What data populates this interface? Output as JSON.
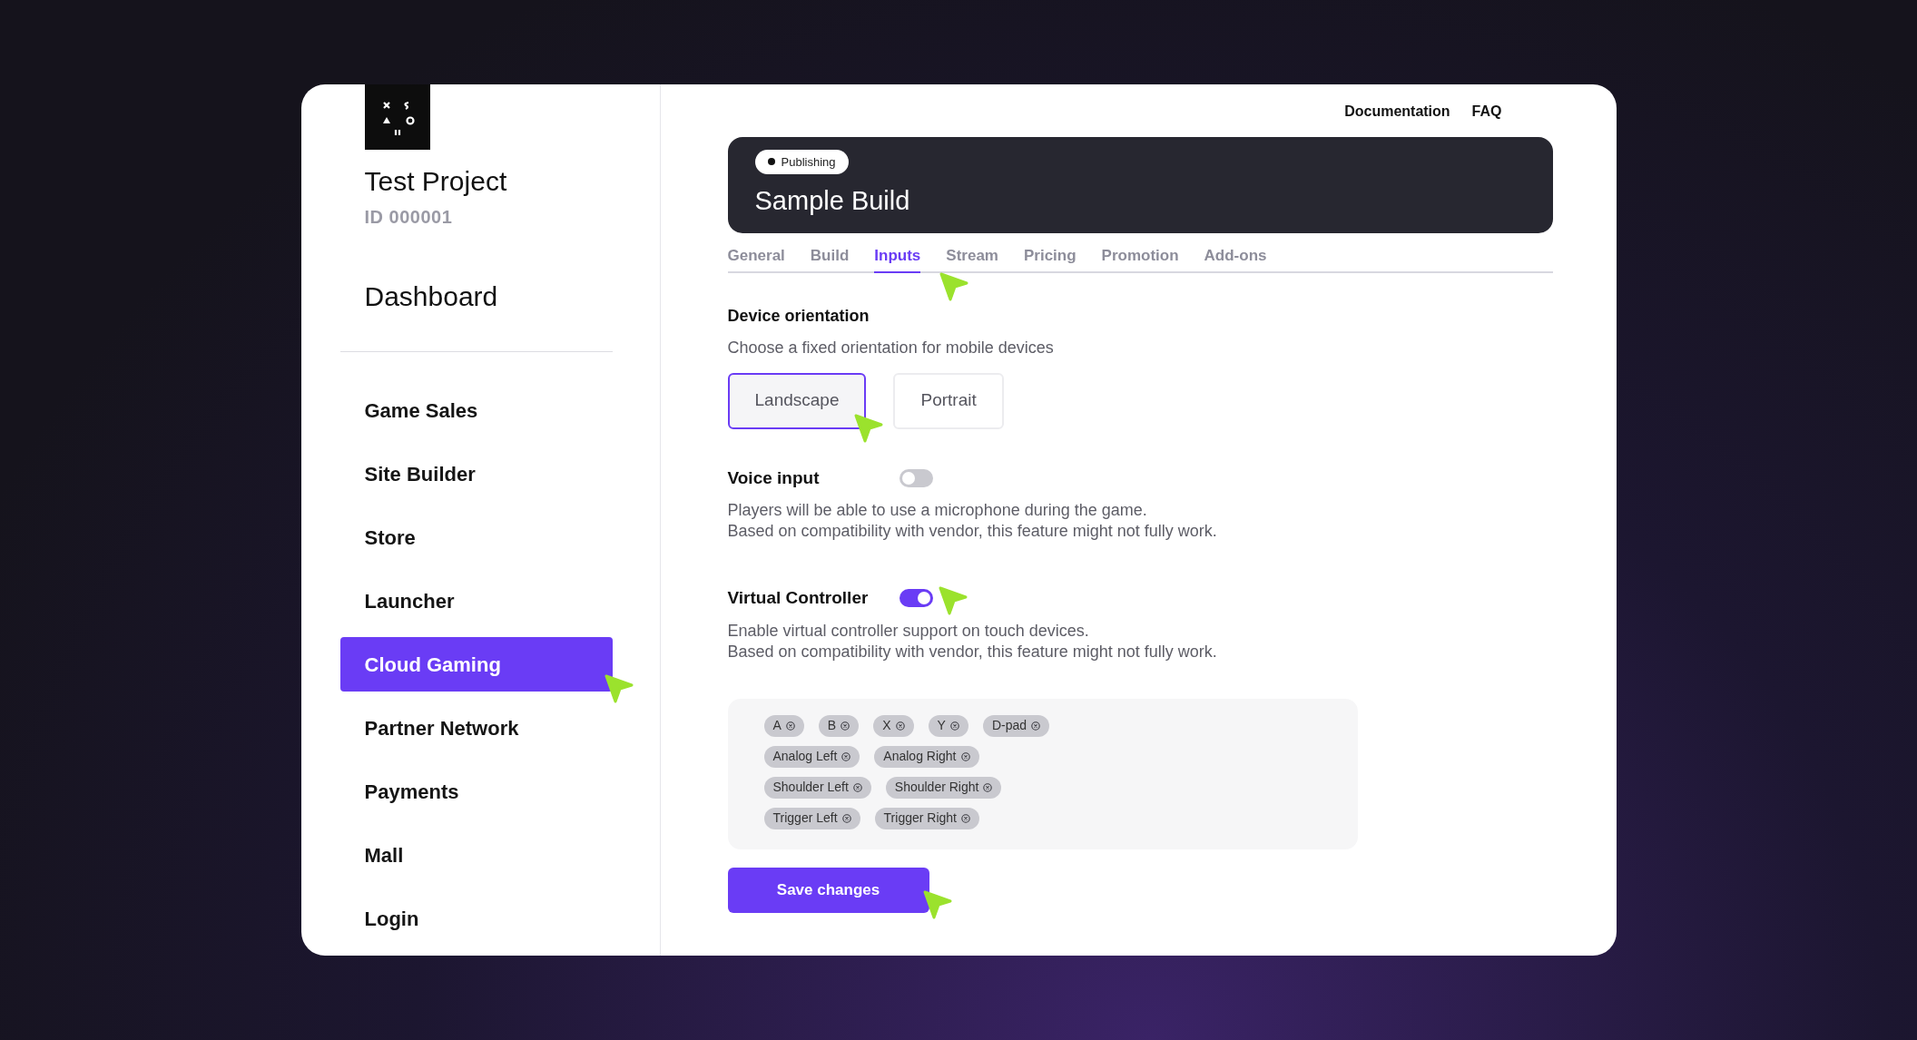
{
  "project": {
    "name": "Test Project",
    "id": "ID 000001"
  },
  "sidebar": {
    "heading": "Dashboard",
    "items": [
      {
        "label": "Game Sales",
        "selected": false
      },
      {
        "label": "Site Builder",
        "selected": false
      },
      {
        "label": "Store",
        "selected": false
      },
      {
        "label": "Launcher",
        "selected": false
      },
      {
        "label": "Cloud Gaming",
        "selected": true
      },
      {
        "label": "Partner Network",
        "selected": false
      },
      {
        "label": "Payments",
        "selected": false
      },
      {
        "label": "Mall",
        "selected": false
      },
      {
        "label": "Login",
        "selected": false
      }
    ]
  },
  "top_links": [
    "Documentation",
    "FAQ"
  ],
  "build": {
    "status": "Publishing",
    "title": "Sample Build"
  },
  "tabs": [
    {
      "label": "General",
      "selected": false
    },
    {
      "label": "Build",
      "selected": false
    },
    {
      "label": "Inputs",
      "selected": true
    },
    {
      "label": "Stream",
      "selected": false
    },
    {
      "label": "Pricing",
      "selected": false
    },
    {
      "label": "Promotion",
      "selected": false
    },
    {
      "label": "Add-ons",
      "selected": false
    }
  ],
  "orientation": {
    "title": "Device orientation",
    "description": "Choose a fixed orientation for mobile devices",
    "options": [
      {
        "label": "Landscape",
        "selected": true
      },
      {
        "label": "Portrait",
        "selected": false
      }
    ]
  },
  "toggles": [
    {
      "label": "Voice input",
      "on": false,
      "description": [
        "Players will be able to use a microphone during the game.",
        "Based on compatibility with vendor, this feature might not fully work."
      ]
    },
    {
      "label": "Virtual Controller",
      "on": true,
      "description": [
        "Enable virtual controller support on touch devices.",
        "Based on compatibility with vendor, this feature might not fully work."
      ]
    }
  ],
  "controller_buttons": [
    [
      "A",
      "B",
      "X",
      "Y",
      "D-pad"
    ],
    [
      "Analog Left",
      "Analog Right"
    ],
    [
      "Shoulder Left",
      "Shoulder Right"
    ],
    [
      "Trigger Left",
      "Trigger Right"
    ]
  ],
  "save_button": "Save changes"
}
